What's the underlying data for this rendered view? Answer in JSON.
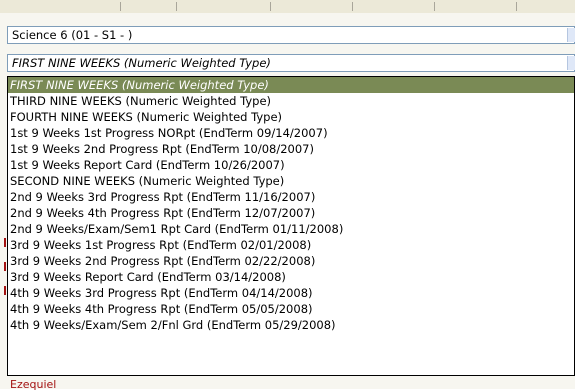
{
  "course_select": {
    "value": "Science 6 (01 - S1 - )"
  },
  "term_select": {
    "value": "FIRST NINE WEEKS (Numeric Weighted Type)"
  },
  "term_options": [
    "FIRST NINE WEEKS (Numeric Weighted Type)",
    "THIRD NINE WEEKS (Numeric Weighted Type)",
    "FOURTH NINE WEEKS (Numeric Weighted Type)",
    "1st 9 Weeks 1st Progress NORpt (EndTerm 09/14/2007)",
    "1st 9 Weeks 2nd Progress Rpt (EndTerm 10/08/2007)",
    "1st 9 Weeks Report Card (EndTerm 10/26/2007)",
    "SECOND NINE WEEKS (Numeric Weighted Type)",
    "2nd 9 Weeks 3rd Progress Rpt (EndTerm 11/16/2007)",
    "2nd 9 Weeks 4th Progress Rpt (EndTerm 12/07/2007)",
    "2nd 9 Weeks/Exam/Sem1 Rpt Card (EndTerm 01/11/2008)",
    "3rd 9 Weeks 1st Progress Rpt (EndTerm 02/01/2008)",
    "3rd 9 Weeks 2nd Progress Rpt (EndTerm 02/22/2008)",
    "3rd 9 Weeks Report Card (EndTerm 03/14/2008)",
    "4th 9 Weeks 3rd Progress Rpt (EndTerm 04/14/2008)",
    "4th 9 Weeks 4th Progress Rpt (EndTerm 05/05/2008)",
    "4th 9 Weeks/Exam/Sem 2/Fnl Grd (EndTerm 05/29/2008)"
  ],
  "selected_index": 0,
  "bottom_label": "Ezequiel",
  "colors": {
    "selection_bg": "#7a8a55",
    "selection_fg": "#ffffff",
    "combo_border": "#7f9db9",
    "student_name": "#a31212"
  }
}
